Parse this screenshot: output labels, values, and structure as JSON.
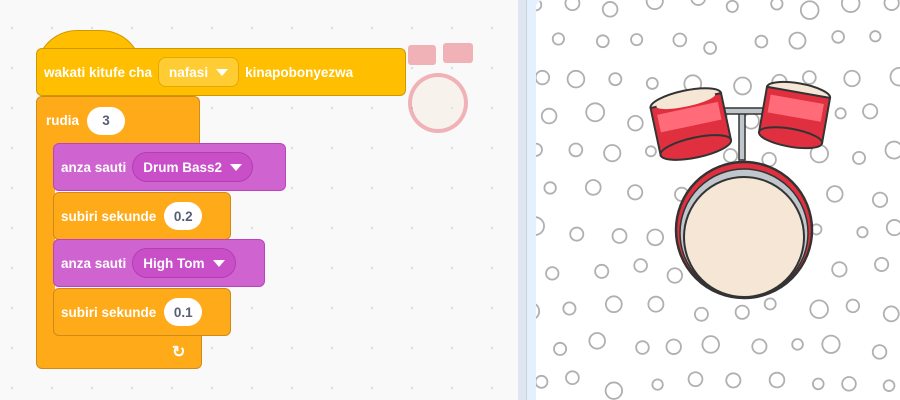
{
  "script": {
    "hat": {
      "prefix": "wakati kitufe cha",
      "key": "nafasi",
      "suffix": "kinapobonyezwa"
    },
    "repeat": {
      "label": "rudia",
      "count": "3"
    },
    "blocks": [
      {
        "label": "anza sauti",
        "value": "Drum Bass2"
      },
      {
        "label": "subiri sekunde",
        "value": "0.2"
      },
      {
        "label": "anza sauti",
        "value": "High Tom"
      },
      {
        "label": "subiri sekunde",
        "value": "0.1"
      }
    ],
    "loop_icon": "loop-arrow-icon"
  },
  "stage": {
    "sprite": "drum-kit",
    "backdrop": "circles-pattern"
  },
  "colors": {
    "events": "#ffbf00",
    "control": "#ffab19",
    "sound": "#cf63cf",
    "workspace": "#f9f9f9",
    "stage_bg": "#ffffff"
  }
}
